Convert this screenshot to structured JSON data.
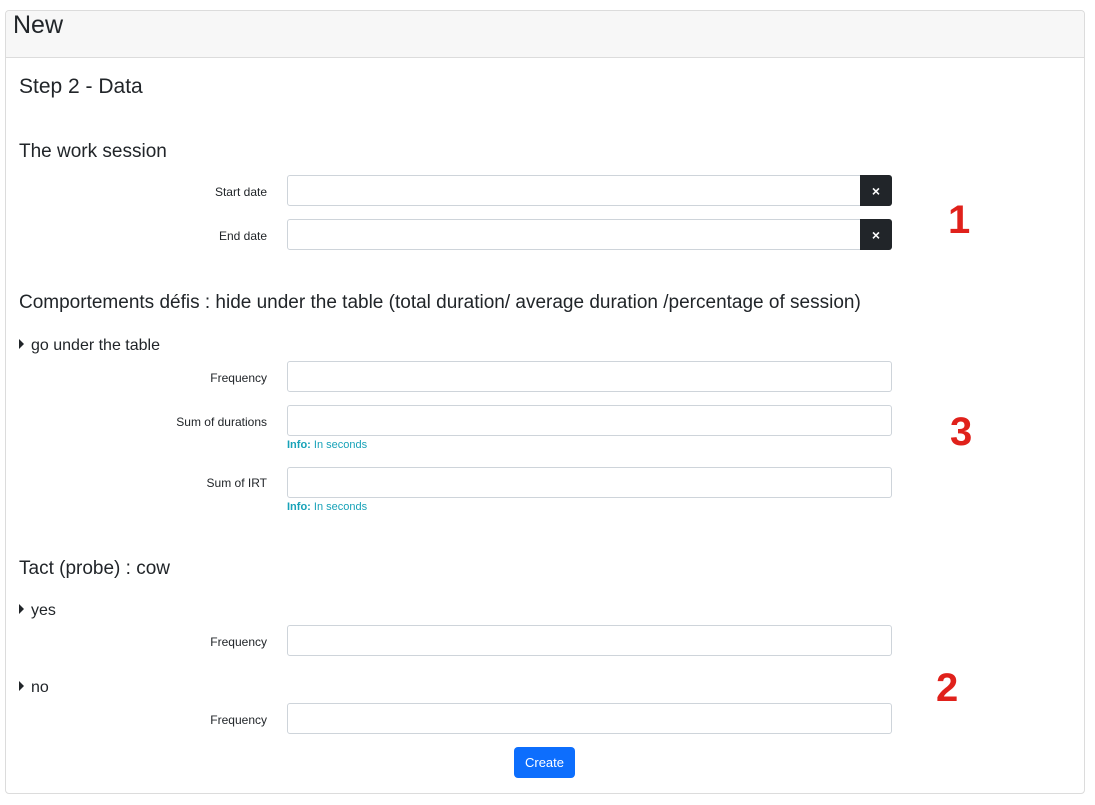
{
  "header": {
    "title": "New"
  },
  "step_title": "Step 2 - Data",
  "work_session": {
    "title": "The work session",
    "start_label": "Start date",
    "end_label": "End date",
    "clear_icon": "×"
  },
  "behaviors": {
    "title": "Comportements défis : hide under the table (total duration/ average duration /percentage of session)",
    "group_label": "go under the table",
    "frequency_label": "Frequency",
    "durations_label": "Sum of durations",
    "irt_label": "Sum of IRT",
    "info_prefix": "Info:",
    "info_text": "In seconds"
  },
  "tact": {
    "title": "Tact (probe) : cow",
    "yes_label": "yes",
    "no_label": "no",
    "frequency_label": "Frequency"
  },
  "markers": {
    "one": "1",
    "two": "2",
    "three": "3"
  },
  "create_label": "Create",
  "colors": {
    "accent": "#0d6efd",
    "info": "#17a2b8",
    "marker": "#e0211b",
    "dark_button": "#212529"
  }
}
